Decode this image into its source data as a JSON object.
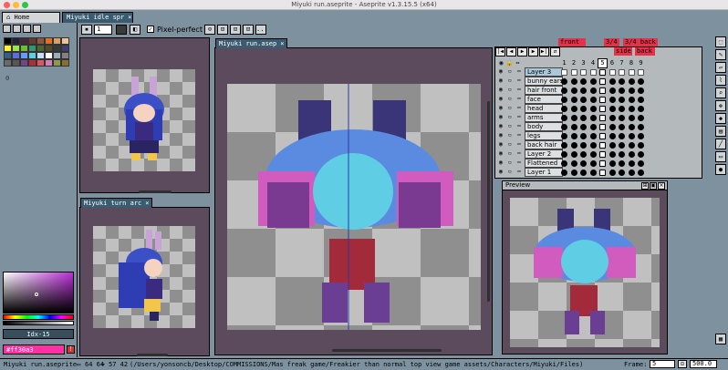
{
  "window": {
    "title": "Miyuki run.aseprite - Aseprite v1.3.15.5 (x64)"
  },
  "tabs": [
    {
      "label": "Home"
    },
    {
      "label": "Miyuki idle spr",
      "close": "×"
    }
  ],
  "context_bar": {
    "brush_size": "1",
    "pixel_perfect_label": "Pixel-perfect",
    "pixel_perfect_check": "✓",
    "ellipsis": "..."
  },
  "palette": {
    "colors": [
      "#000000",
      "#222034",
      "#45283c",
      "#663931",
      "#8f563b",
      "#df7126",
      "#d9a066",
      "#eec39a",
      "#fbf236",
      "#99e550",
      "#6abe30",
      "#37946e",
      "#4b692f",
      "#524b24",
      "#323c39",
      "#3f3f74",
      "#306082",
      "#5b6ee1",
      "#639bff",
      "#5fcde4",
      "#cbdbfc",
      "#ffffff",
      "#9badb7",
      "#847e87",
      "#696a6a",
      "#595652",
      "#76428a",
      "#ac3232",
      "#d95763",
      "#d77bba",
      "#8f974a",
      "#8a6f30"
    ],
    "index_marker": "0"
  },
  "color": {
    "index_label": "Idx-15",
    "hex_label": "#ff30a3",
    "warning_icon": "!"
  },
  "sprites": {
    "idle": {
      "title": "Miyuki idle spr",
      "close": "×"
    },
    "turn": {
      "title": "Miyuki turn arc",
      "close": "×"
    },
    "run": {
      "title": "Miyuki run.asep",
      "close": "×"
    }
  },
  "timeline": {
    "tags": [
      {
        "label": "front",
        "color": "#e3334b"
      },
      {
        "label": "3/4",
        "color": "#e3334b"
      },
      {
        "label": "3/4 back",
        "color": "#e3334b"
      },
      {
        "label": "side",
        "color": "#e3334b"
      },
      {
        "label": "back",
        "color": "#e3334b"
      }
    ],
    "frames": [
      "1",
      "2",
      "3",
      "4",
      "5",
      "6",
      "7",
      "8",
      "9"
    ],
    "selected_frame": "5",
    "layers": [
      {
        "name": "Layer 3",
        "active": true
      },
      {
        "name": "bunny ears"
      },
      {
        "name": "hair front"
      },
      {
        "name": "face"
      },
      {
        "name": "head"
      },
      {
        "name": "arms"
      },
      {
        "name": "body"
      },
      {
        "name": "legs"
      },
      {
        "name": "back hair"
      },
      {
        "name": "Layer 2"
      },
      {
        "name": "Flattened"
      },
      {
        "name": "Layer 1"
      }
    ]
  },
  "preview": {
    "title": "Preview",
    "btn_a": "⊞",
    "btn_b": "▣",
    "btn_close": "×"
  },
  "status": {
    "filename": "Miyuki run.aseprite",
    "size_icon": "▭",
    "size": "64 64",
    "pos_icon": "⌖",
    "position": "57 42",
    "path": "(/Users/yonsoncb/Desktop/COMMISSIONS/Mas freak game/Freakier than normal top view game assets/Characters/Miyuki/Files)",
    "frame_label": "Frame:",
    "frame_value": "5",
    "zoom_value": "500.0"
  }
}
